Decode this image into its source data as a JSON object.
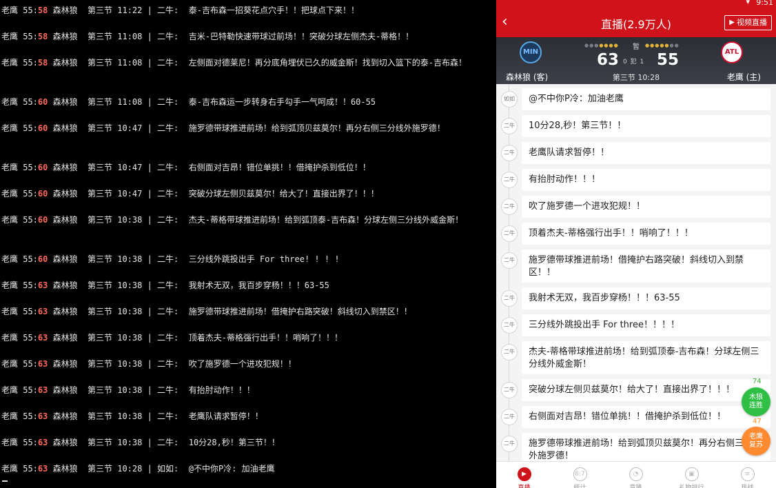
{
  "terminal": {
    "lines": [
      {
        "pre": "老鹰 55:",
        "hi": "58",
        "post": " 森林狼  第三节 11:22 | 二牛:  泰-吉布森一招葵花点穴手！！把球点下来！！",
        "row": 0
      },
      {
        "pre": "老鹰 55:",
        "hi": "58",
        "post": " 森林狼  第三节 11:08 | 二牛:  吉米-巴特勒快速带球过前场！！突破分球左侧杰夫-蒂格！！",
        "row": 1
      },
      {
        "pre": "老鹰 55:",
        "hi": "58",
        "post": " 森林狼  第三节 11:08 | 二牛:  左侧面对德莱尼！再分底角埋伏已久的威金斯！找到切入篮下的泰-吉布森！",
        "row": 2
      },
      {
        "pre": "老鹰 55:",
        "hi": "60",
        "post": " 森林狼  第三节 11:08 | 二牛:  泰-吉布森运一步转身右手勾手一气呵成！！60-55",
        "row": 3
      },
      {
        "pre": "老鹰 55:",
        "hi": "60",
        "post": " 森林狼  第三节 10:47 | 二牛:  施罗德带球推进前场！给到弧顶贝兹莫尔！再分右侧三分线外施罗德！",
        "row": 4
      },
      {
        "pre": "老鹰 55:",
        "hi": "60",
        "post": " 森林狼  第三节 10:47 | 二牛:  右侧面对吉昂！错位单挑！！借掩护杀到低位！！",
        "row": 5
      },
      {
        "pre": "老鹰 55:",
        "hi": "60",
        "post": " 森林狼  第三节 10:47 | 二牛:  突破分球左侧贝兹莫尔！给大了！直接出界了！！！",
        "row": 6
      },
      {
        "pre": "老鹰 55:",
        "hi": "60",
        "post": " 森林狼  第三节 10:38 | 二牛:  杰夫-蒂格带球推进前场！给到弧顶泰-吉布森！分球左侧三分线外威金斯！",
        "row": 7
      },
      {
        "pre": "老鹰 55:",
        "hi": "60",
        "post": " 森林狼  第三节 10:38 | 二牛:  三分线外跳投出手 For three! ! ! !",
        "row": 8
      },
      {
        "pre": "老鹰 55:",
        "hi": "63",
        "post": " 森林狼  第三节 10:38 | 二牛:  我射术无双，我百步穿杨！！！63-55",
        "row": 9
      },
      {
        "pre": "老鹰 55:",
        "hi": "63",
        "post": " 森林狼  第三节 10:38 | 二牛:  施罗德带球推进前场！借掩护右路突破！斜线切入到禁区！！",
        "row": 10
      },
      {
        "pre": "老鹰 55:",
        "hi": "63",
        "post": " 森林狼  第三节 10:38 | 二牛:  顶着杰夫-蒂格强行出手！！哨响了！！！",
        "row": 11
      },
      {
        "pre": "老鹰 55:",
        "hi": "63",
        "post": " 森林狼  第三节 10:38 | 二牛:  吹了施罗德一个进攻犯规！！",
        "row": 12
      },
      {
        "pre": "老鹰 55:",
        "hi": "63",
        "post": " 森林狼  第三节 10:38 | 二牛:  有抬肘动作！！！",
        "row": 13
      },
      {
        "pre": "老鹰 55:",
        "hi": "63",
        "post": " 森林狼  第三节 10:38 | 二牛:  老鹰队请求暂停！！",
        "row": 14
      },
      {
        "pre": "老鹰 55:",
        "hi": "63",
        "post": " 森林狼  第三节 10:38 | 二牛:  10分28,秒！第三节！！",
        "row": 15
      },
      {
        "pre": "老鹰 55:",
        "hi": "63",
        "post": " 森林狼  第三节 10:28 | 如如:  @不中你P冷: 加油老鹰",
        "row": 16
      }
    ]
  },
  "phone": {
    "status": {
      "time": "9:51",
      "wifi_icon": "wifi-icon"
    },
    "appbar": {
      "back": "‹",
      "title": "直播(2.9万人)",
      "video_label": "视频直播"
    },
    "score": {
      "away_abbr": "MIN",
      "home_abbr": "ATL",
      "away_score": "63",
      "home_score": "55",
      "pause": "暂",
      "fouls_label": "0 犯 1",
      "away_name": "森林狼 (客)",
      "home_name": "老鹰 (主)",
      "period": "第三节 10:28"
    },
    "feed": [
      {
        "avatar": "如如",
        "text": "@不中你P冷：加油老鹰"
      },
      {
        "avatar": "二牛",
        "text": "10分28,秒！第三节！！"
      },
      {
        "avatar": "二牛",
        "text": "老鹰队请求暂停！！"
      },
      {
        "avatar": "二牛",
        "text": "有抬肘动作！！！"
      },
      {
        "avatar": "二牛",
        "text": "吹了施罗德一个进攻犯规！！"
      },
      {
        "avatar": "二牛",
        "text": "顶着杰夫-蒂格强行出手！！哨响了！！！"
      },
      {
        "avatar": "二牛",
        "text": "施罗德带球推进前场！借掩护右路突破！斜线切入到禁区！！"
      },
      {
        "avatar": "二牛",
        "text": "我射术无双，我百步穿杨！！！63-55"
      },
      {
        "avatar": "二牛",
        "text": "三分线外跳投出手 For three！！！！"
      },
      {
        "avatar": "二牛",
        "text": "杰夫-蒂格带球推进前场！给到弧顶泰-吉布森！分球左侧三分线外威金斯！"
      },
      {
        "avatar": "二牛",
        "text": "突破分球左侧贝兹莫尔！给大了！直接出界了！！！"
      },
      {
        "avatar": "二牛",
        "text": "右侧面对吉昂！错位单挑！！借掩护杀到低位！！"
      },
      {
        "avatar": "二牛",
        "text": "施罗德带球推进前场！给到弧顶贝兹莫尔！再分右侧三分线外施罗德！"
      }
    ],
    "vote": {
      "wolves_count": "74",
      "wolves_label": "木狼\n连胜",
      "hawks_count": "47",
      "hawks_label": "老鹰\n复苏",
      "colors": {
        "wolves": "#2fbf45",
        "hawks": "#ff8a30"
      }
    },
    "nav": [
      {
        "label": "直播",
        "icon": "play-circle-icon",
        "glyph": "▶",
        "active": true
      },
      {
        "label": "统计",
        "icon": "scoreboard-icon",
        "glyph": "8:7",
        "active": false
      },
      {
        "label": "竞猜",
        "icon": "leaf-icon",
        "glyph": "◔",
        "active": false
      },
      {
        "label": "礼物排行",
        "icon": "gift-icon",
        "glyph": "▣",
        "active": false
      },
      {
        "label": "热线",
        "icon": "chat-icon",
        "glyph": "≡",
        "active": false
      }
    ],
    "colors": {
      "brand": "#d0121b",
      "scoreboard": "#2b2e35"
    }
  }
}
